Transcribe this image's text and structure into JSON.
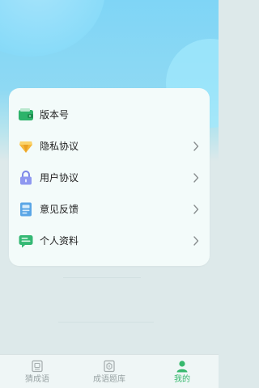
{
  "menu": {
    "items": [
      {
        "label": "版本号",
        "icon": "wallet-icon",
        "has_chevron": false
      },
      {
        "label": "隐私协议",
        "icon": "diamond-icon",
        "has_chevron": true
      },
      {
        "label": "用户协议",
        "icon": "lock-icon",
        "has_chevron": true
      },
      {
        "label": "意见反馈",
        "icon": "feedback-document-icon",
        "has_chevron": true
      },
      {
        "label": "个人资料",
        "icon": "chat-profile-icon",
        "has_chevron": true
      }
    ]
  },
  "tabbar": {
    "tabs": [
      {
        "label": "猜成语",
        "icon": "quiz-card-icon",
        "active": false
      },
      {
        "label": "成语题库",
        "icon": "question-bank-icon",
        "active": false
      },
      {
        "label": "我的",
        "icon": "person-icon",
        "active": true
      }
    ]
  },
  "colors": {
    "accent_active": "#36b86d",
    "header_blue": "#7fd5f6",
    "card_bg": "#f3fbfa",
    "page_bg": "#dde9ea"
  }
}
